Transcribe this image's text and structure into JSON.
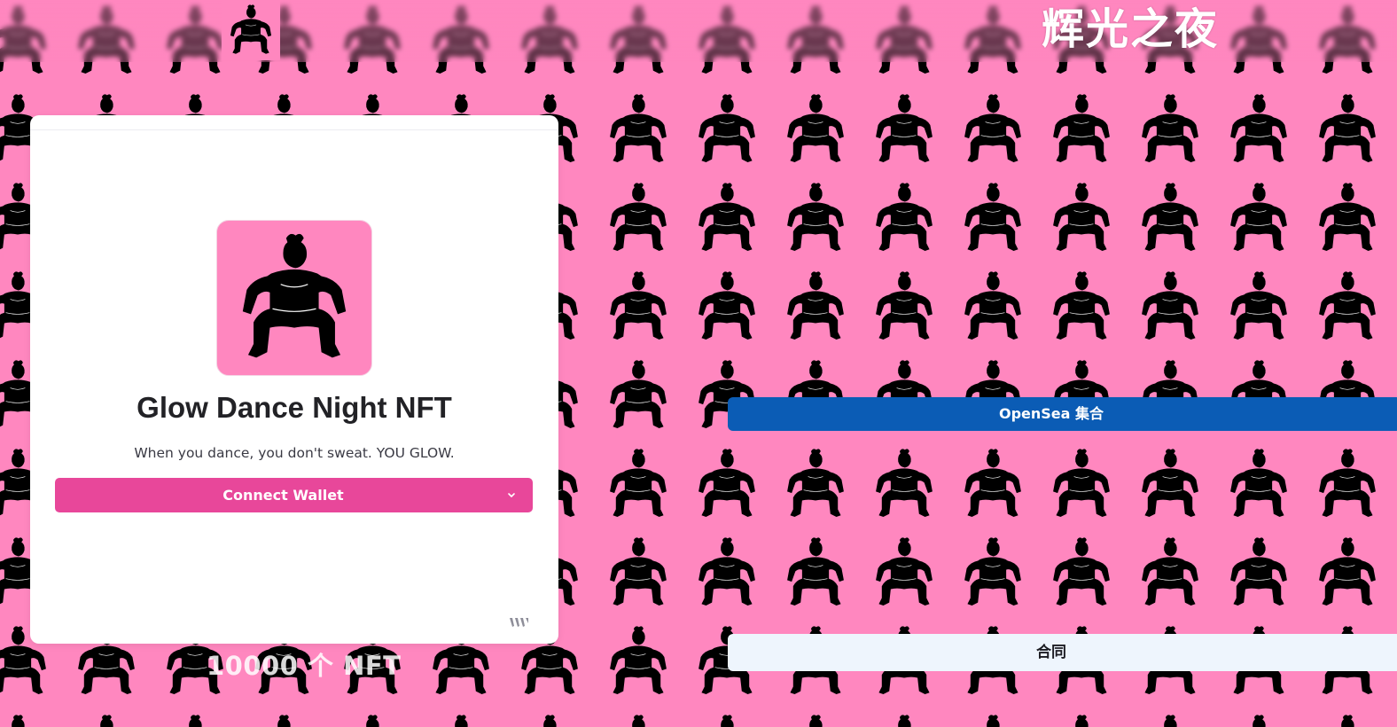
{
  "header": {
    "site_title": "辉光之夜",
    "logo_icon": "dancer-silhouette-icon"
  },
  "mint_card": {
    "image_icon": "dancer-silhouette-icon",
    "collection_name": "Glow Dance Night NFT",
    "description": "When you dance, you don't sweat. YOU GLOW.",
    "connect_wallet_label": "Connect Wallet",
    "dropdown_icon": "chevron-down-icon",
    "footer_icon": "thirdweb-logo-icon"
  },
  "stats": {
    "nft_count": "10000 个 NFT"
  },
  "links": {
    "opensea_label": "OpenSea 集合",
    "contract_label": "合同"
  },
  "colors": {
    "background_pink": "#ff87bf",
    "connect_wallet_bg": "#e8479a",
    "opensea_blue": "#0b5cb5",
    "contract_bg": "#eef5fd",
    "card_bg": "#ffffff",
    "silhouette": "#000000"
  }
}
